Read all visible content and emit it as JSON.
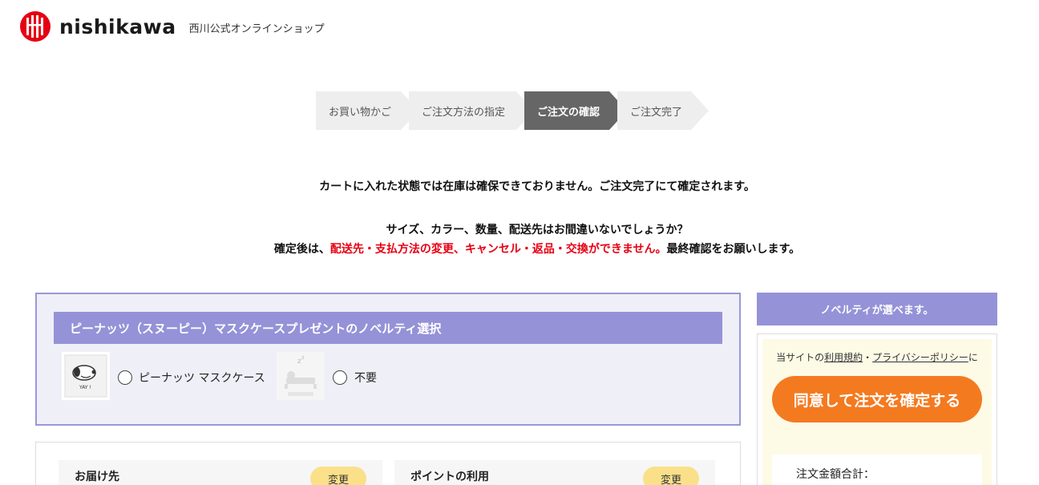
{
  "header": {
    "brand": "nishikawa",
    "tagline": "西川公式オンラインショップ"
  },
  "steps": [
    {
      "label": "お買い物かご",
      "active": false
    },
    {
      "label": "ご注文方法の指定",
      "active": false
    },
    {
      "label": "ご注文の確認",
      "active": true
    },
    {
      "label": "ご注文完了",
      "active": false
    }
  ],
  "notices": {
    "line1": "カートに入れた状態では在庫は確保できておりません。ご注文完了にて確定されます。",
    "line2": "サイズ、カラー、数量、配送先はお間違いないでしょうか？",
    "line3_prefix": "確定後は、",
    "line3_red": "配送先・支払方法の変更、キャンセル・返品・交換ができません。",
    "line3_suffix": "最終確認をお願いします。"
  },
  "novelty": {
    "title": "ピーナッツ（スヌーピー）マスクケースプレゼントのノベルティ選択",
    "options": [
      {
        "label": "ピーナッツ マスクケース",
        "icon": "snoopy-mask-case-icon",
        "selected": false
      },
      {
        "label": "不要",
        "icon": "sleeping-placeholder-icon",
        "selected": false
      }
    ]
  },
  "panels": {
    "delivery_title": "お届け先",
    "delivery_change": "変更",
    "points_title": "ポイントの利用",
    "points_change": "変更"
  },
  "sidebar": {
    "header": "ノベルティが選べます。",
    "terms_prefix": "当サイトの",
    "terms_link": "利用規約",
    "terms_sep": "・",
    "privacy_link": "プライバシーポリシー",
    "terms_suffix": "に",
    "confirm_button": "同意して注文を確定する",
    "total_label": "注文金額合計："
  },
  "colors": {
    "accent_purple": "#9592d8",
    "accent_orange": "#f47a20",
    "warning_red": "#e60012",
    "logo_red": "#e60012",
    "change_button_yellow": "#fbe08a"
  }
}
